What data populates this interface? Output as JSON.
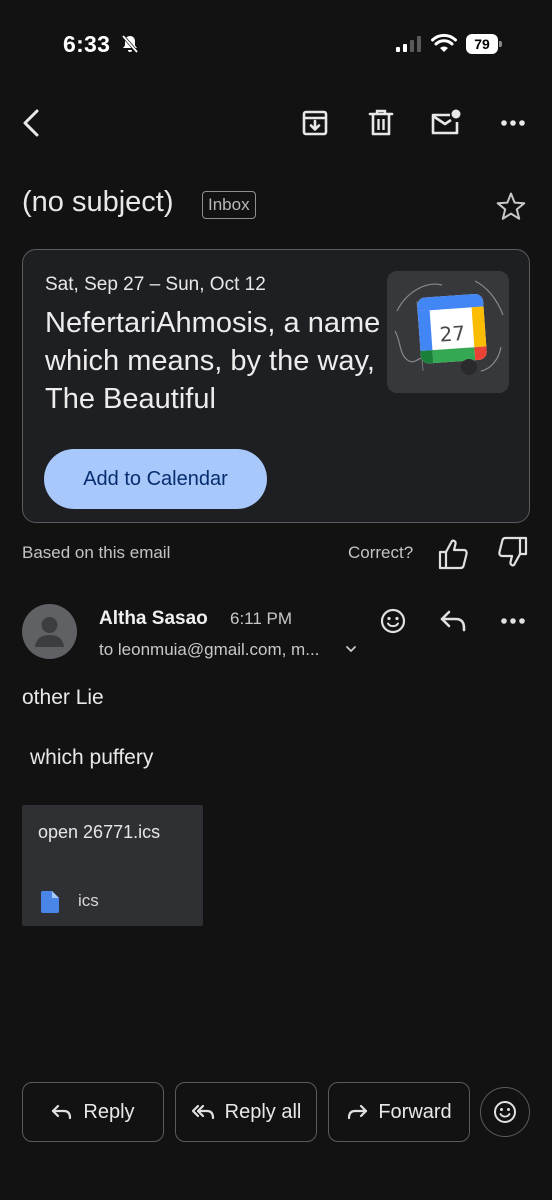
{
  "status_bar": {
    "time": "6:33",
    "battery": "79"
  },
  "toolbar": {
    "back_icon": "back-arrow-icon",
    "archive_icon": "archive-icon",
    "delete_icon": "trash-icon",
    "mark_unread_icon": "mark-unread-icon",
    "more_icon": "more-horizontal-icon"
  },
  "email": {
    "subject": "(no subject)",
    "label": "Inbox"
  },
  "event_card": {
    "date_range": "Sat, Sep 27 – Sun, Oct 12",
    "title": "NefertariAhmosis, a name which means, by the way, The Beautiful",
    "calendar_day": "27",
    "add_button": "Add to Calendar"
  },
  "feedback": {
    "based_on": "Based on this email",
    "correct": "Correct?"
  },
  "sender": {
    "name": "Altha Sasao",
    "time": "6:11 PM",
    "recipients": "to leonmuia@gmail.com, m..."
  },
  "body": {
    "line1": "other Lie",
    "line2": "which puffery"
  },
  "attachment": {
    "name": "open 26771.ics",
    "type": "ics"
  },
  "actions": {
    "reply": "Reply",
    "reply_all": "Reply all",
    "forward": "Forward"
  },
  "colors": {
    "background": "#121213",
    "card": "#1e1f22",
    "accent_button": "#a8c7fa",
    "accent_text": "#062e6f"
  }
}
